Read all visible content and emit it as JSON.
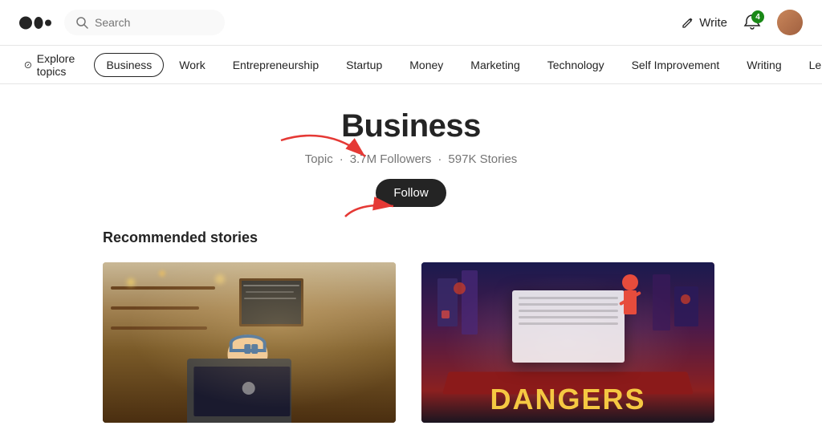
{
  "header": {
    "logo_alt": "Medium logo",
    "search_placeholder": "Search",
    "write_label": "Write",
    "notif_count": "4",
    "avatar_alt": "User avatar"
  },
  "topic_nav": {
    "explore_label": "Explore topics",
    "items": [
      {
        "label": "Business",
        "active": true
      },
      {
        "label": "Work",
        "active": false
      },
      {
        "label": "Entrepreneurship",
        "active": false
      },
      {
        "label": "Startup",
        "active": false
      },
      {
        "label": "Money",
        "active": false
      },
      {
        "label": "Marketing",
        "active": false
      },
      {
        "label": "Technology",
        "active": false
      },
      {
        "label": "Self Improvement",
        "active": false
      },
      {
        "label": "Writing",
        "active": false
      },
      {
        "label": "Le...",
        "active": false
      }
    ]
  },
  "topic_page": {
    "title": "Business",
    "meta_type": "Topic",
    "followers": "3.7M Followers",
    "stories": "597K Stories",
    "follow_label": "Follow"
  },
  "recommended": {
    "section_title": "Recommended stories",
    "cards": [
      {
        "image_type": "coffee",
        "alt": "Person with laptop in coffee shop"
      },
      {
        "image_type": "dangers",
        "alt": "Dangers illustration"
      }
    ]
  }
}
